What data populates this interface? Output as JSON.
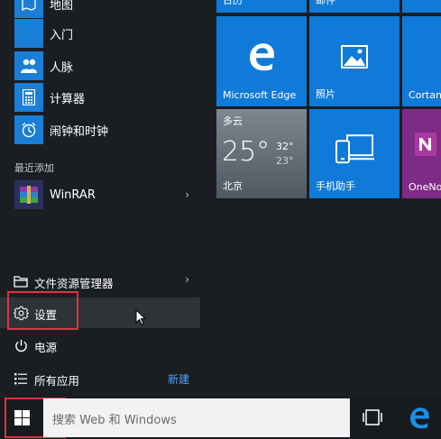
{
  "left_menu": {
    "apps": [
      {
        "label": "地图",
        "icon": "map-icon"
      },
      {
        "label": "入门",
        "icon": "lightbulb-icon"
      },
      {
        "label": "人脉",
        "icon": "people-icon"
      },
      {
        "label": "计算器",
        "icon": "calculator-icon"
      },
      {
        "label": "闹钟和时钟",
        "icon": "alarm-clock-icon"
      }
    ],
    "recent_section_label": "最近添加",
    "recent_apps": [
      {
        "label": "WinRAR",
        "icon": "winrar-icon"
      }
    ],
    "system": {
      "explorer_label": "文件资源管理器",
      "settings_label": "设置",
      "power_label": "电源",
      "all_apps_label": "所有应用",
      "new_label": "新建"
    }
  },
  "tiles": {
    "calendar_label": "日历",
    "mail_label": "邮件",
    "edge_label": "Microsoft Edge",
    "photos_label": "照片",
    "cortana_label": "Cortana",
    "weather": {
      "condition": "多云",
      "temp": "25°",
      "high": "32°",
      "low": "23°",
      "city": "北京"
    },
    "phone_label": "手机助手",
    "onenote_label": "OneNote"
  },
  "taskbar": {
    "search_placeholder": "搜索 Web 和 Windows"
  },
  "colors": {
    "accent": "#0f7ad8",
    "highlight_box": "#e0323c",
    "menu_bg": "#1a1e22",
    "onenote": "#7f2a87"
  }
}
